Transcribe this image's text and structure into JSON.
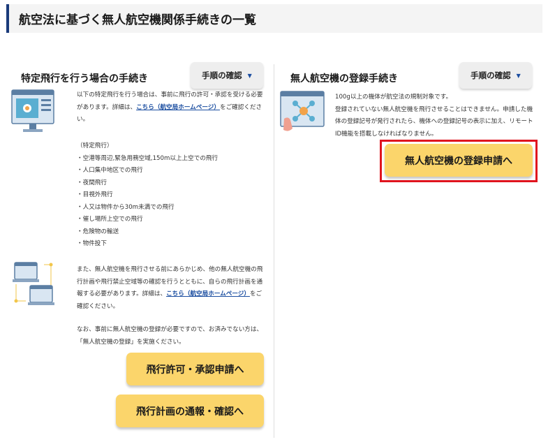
{
  "header": {
    "title": "航空法に基づく無人航空機関係手続きの一覧"
  },
  "left": {
    "title": "特定飛行を行う場合の手続き",
    "steps_button": "手順の確認",
    "steps_caret": "▼",
    "p1_before": "以下の特定飛行を行う場合は、事前に飛行の許可・承認を受ける必要があります。詳細は、",
    "p1_link": "こちら（航空局ホームページ）",
    "p1_after": "をご確認ください。",
    "list_heading": "（特定飛行）",
    "list": [
      "・空港等周辺,緊急用務空域,150m以上上空での飛行",
      "・人口集中地区での飛行",
      "・夜間飛行",
      "・目視外飛行",
      "・人又は物件から30m未満での飛行",
      "・催し場所上空での飛行",
      "・危険物の輸送",
      "・物件投下"
    ],
    "p2_before": "また、無人航空機を飛行させる前にあらかじめ、他の無人航空機の飛行計画や飛行禁止空域等の確認を行うとともに、自らの飛行計画を通報する必要があります。詳細は、",
    "p2_link": "こちら（航空局ホームページ）",
    "p2_after": "をご確認ください。",
    "p3": "なお、事前に無人航空機の登録が必要ですので、お済みでない方は、「無人航空機の登録」を実施ください。",
    "btn_permit": "飛行許可・承認申請へ",
    "btn_plan": "飛行計画の通報・確認へ"
  },
  "right": {
    "title": "無人航空機の登録手続き",
    "steps_button": "手順の確認",
    "steps_caret": "▼",
    "p1": "100g以上の機体が航空法の規制対象です。",
    "p2": "登録されていない無人航空機を飛行させることはできません。申請した機体の登録記号が発行されたら、機体への登録記号の表示に加え、リモートID機能を搭載しなければなりません。",
    "btn_register": "無人航空機の登録申請へ"
  },
  "colors": {
    "accent": "#1a3a7a",
    "button_yellow": "#fbd56b",
    "link": "#1a4da0",
    "highlight": "#e0141e"
  }
}
